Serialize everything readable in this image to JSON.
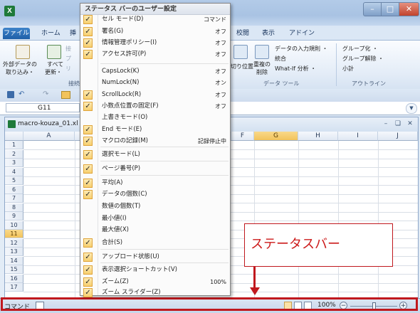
{
  "app": {
    "logo_letter": "X"
  },
  "tabs": [
    "ファイル",
    "ホーム",
    "挿",
    "校閲",
    "表示",
    "アドイン"
  ],
  "ribbon": {
    "get_external_data": [
      "外部データの",
      "取り込み・"
    ],
    "refresh_all": [
      "すべて",
      "更新・"
    ],
    "connections_group": "接続",
    "faded_items": [
      "接",
      "プ",
      "リ"
    ],
    "remove_dup": [
      "重複の",
      "削除"
    ],
    "consolidate_prefix": "切り位置",
    "data_validation": "データの入力規則 ・",
    "consolidate": "統合",
    "whatif": "What-If 分析 ・",
    "data_tools_group": "データ ツール",
    "group": "グループ化 ・",
    "ungroup": "グループ解除 ・",
    "subtotal": "小計",
    "outline_group": "アウトライン"
  },
  "formula_bar": {
    "name_box": "G11",
    "expand_icon": "chevron-down-icon"
  },
  "workbook": {
    "title": "macro-kouza_01.xl",
    "columns": [
      "A",
      "F",
      "G",
      "H",
      "I",
      "J"
    ],
    "rows": [
      "1",
      "2",
      "3",
      "4",
      "5",
      "6",
      "7",
      "8",
      "9",
      "10",
      "11",
      "12",
      "13",
      "14",
      "15",
      "16",
      "17"
    ],
    "selected_cell": "G11",
    "selected_column": "G",
    "selected_row": "11"
  },
  "context_menu": {
    "title": "ステータス バーのユーザー設定",
    "items": [
      {
        "label": "セル モード(D)",
        "value": "コマンド",
        "checked": true
      },
      {
        "label": "署名(G)",
        "value": "オフ",
        "checked": true
      },
      {
        "label": "情報管理ポリシー(I)",
        "value": "オフ",
        "checked": true
      },
      {
        "label": "アクセス許可(P)",
        "value": "オフ",
        "checked": true
      },
      {
        "label": "CapsLock(K)",
        "value": "オフ",
        "checked": false
      },
      {
        "label": "NumLock(N)",
        "value": "オン",
        "checked": false
      },
      {
        "label": "ScrollLock(R)",
        "value": "オフ",
        "checked": true
      },
      {
        "label": "小数点位置の固定(F)",
        "value": "オフ",
        "checked": true
      },
      {
        "label": "上書きモード(O)",
        "value": "",
        "checked": false
      },
      {
        "label": "End モード(E)",
        "value": "",
        "checked": true
      },
      {
        "label": "マクロの記録(M)",
        "value": "記録停止中",
        "checked": true
      },
      {
        "label": "選択モード(L)",
        "value": "",
        "checked": true
      },
      {
        "label": "ページ番号(P)",
        "value": "",
        "checked": true
      },
      {
        "label": "平均(A)",
        "value": "",
        "checked": true
      },
      {
        "label": "データの個数(C)",
        "value": "",
        "checked": true
      },
      {
        "label": "数値の個数(T)",
        "value": "",
        "checked": false
      },
      {
        "label": "最小値(I)",
        "value": "",
        "checked": false
      },
      {
        "label": "最大値(X)",
        "value": "",
        "checked": false
      },
      {
        "label": "合計(S)",
        "value": "",
        "checked": true
      },
      {
        "label": "アップロード状態(U)",
        "value": "",
        "checked": true
      },
      {
        "label": "表示選択ショートカット(V)",
        "value": "",
        "checked": true
      },
      {
        "label": "ズーム(Z)",
        "value": "100%",
        "checked": true
      },
      {
        "label": "ズーム スライダー(Z)",
        "value": "",
        "checked": true
      }
    ]
  },
  "status_bar": {
    "mode": "コマンド",
    "zoom": "100%",
    "zoom_level": 1.0,
    "minus": "−",
    "plus": "+"
  },
  "annotation": {
    "text": "ステータスバー"
  },
  "colors": {
    "highlight": "#c0181e",
    "accent": "#1f5fa8",
    "excel_green": "#1f7a3a"
  }
}
